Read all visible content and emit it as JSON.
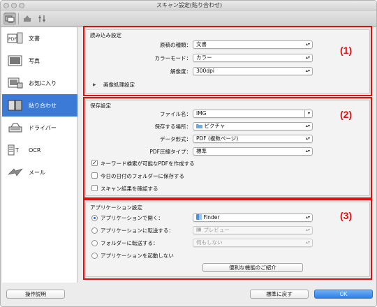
{
  "window": {
    "title": "スキャン設定(貼り合わせ)"
  },
  "toolbar": {
    "buttons": [
      {
        "icon": "scan-from-computer-icon"
      },
      {
        "icon": "scan-from-panel-icon"
      },
      {
        "icon": "general-settings-icon"
      }
    ]
  },
  "sidebar": {
    "items": [
      {
        "label": "文書",
        "icon": "document-icon",
        "selected": false
      },
      {
        "label": "写真",
        "icon": "photo-icon",
        "selected": false
      },
      {
        "label": "お気に入り",
        "icon": "favorite-icon",
        "selected": false
      },
      {
        "label": "貼り合わせ",
        "icon": "stitch-icon",
        "selected": true
      },
      {
        "label": "ドライバー",
        "icon": "driver-icon",
        "selected": false
      },
      {
        "label": "OCR",
        "icon": "ocr-icon",
        "selected": false
      },
      {
        "label": "メール",
        "icon": "email-icon",
        "selected": false
      }
    ]
  },
  "scan_options": {
    "title": "読み込み設定",
    "number": "(1)",
    "source_type_label": "原稿の種類：",
    "source_type_value": "文書",
    "color_mode_label": "カラーモード：",
    "color_mode_value": "カラー",
    "resolution_label": "解像度：",
    "resolution_value": "300dpi",
    "image_processing_label": "画像処理設定"
  },
  "save_settings": {
    "title": "保存設定",
    "number": "(2)",
    "file_name_label": "ファイル名：",
    "file_name_value": "IMG",
    "save_in_label": "保存する場所：",
    "save_in_value": "ピクチャ",
    "data_format_label": "データ形式：",
    "data_format_value": "PDF (複数ページ)",
    "pdf_compression_label": "PDF圧縮タイプ：",
    "pdf_compression_value": "標準",
    "checkbox_searchable_pdf": {
      "label": "キーワード検索が可能なPDFを作成する",
      "checked": true
    },
    "checkbox_date_folder": {
      "label": "今日の日付のフォルダーに保存する",
      "checked": false
    },
    "checkbox_check_results": {
      "label": "スキャン結果を確認する",
      "checked": false
    }
  },
  "app_settings": {
    "title": "アプリケーション設定",
    "number": "(3)",
    "open_with_label": "アプリケーションで開く：",
    "open_with_value": "Finder",
    "send_to_app_label": "アプリケーションに転送する：",
    "send_to_app_value": "プレビュー",
    "send_to_folder_label": "フォルダーに転送する：",
    "send_to_folder_value": "何もしない",
    "do_not_start_label": "アプリケーションを起動しない",
    "more_functions_label": "便利な機能のご紹介",
    "selected": "open_with"
  },
  "footer": {
    "instructions_label": "操作説明",
    "defaults_label": "標準に戻す",
    "ok_label": "OK"
  },
  "colors": {
    "highlight": "#e01010",
    "selection": "#3b7bd7",
    "ok_button": "#2f7fe6"
  }
}
